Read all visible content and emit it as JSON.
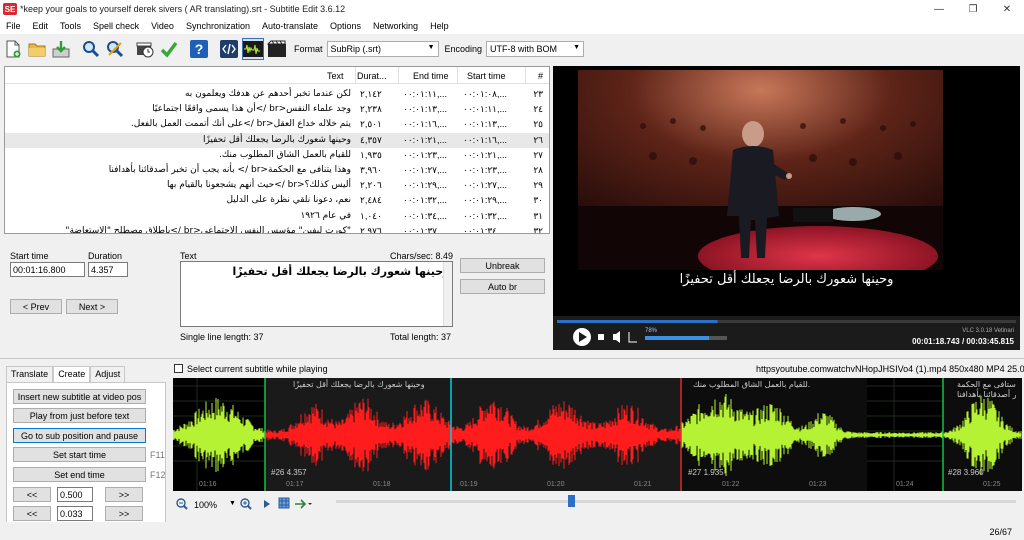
{
  "window": {
    "app_icon": "SE",
    "title": "*keep your goals to yourself derek sivers ( AR translating).srt - Subtitle Edit 3.6.12",
    "minimize": "—",
    "restore": "❐",
    "close": "✕"
  },
  "menu": [
    "File",
    "Edit",
    "Tools",
    "Spell check",
    "Video",
    "Synchronization",
    "Auto-translate",
    "Options",
    "Networking",
    "Help"
  ],
  "toolbar": {
    "icons": [
      "new-file-icon",
      "open-folder-icon",
      "save-icon",
      "find-icon",
      "replace-icon",
      "visual-sync-icon",
      "spell-check-icon",
      "help-icon",
      "source-view-icon",
      "waveform-toggle-icon",
      "video-toggle-icon"
    ],
    "format_label": "Format",
    "format_value": "SubRip (.srt)",
    "encoding_label": "Encoding",
    "encoding_value": "UTF-8 with BOM"
  },
  "list": {
    "headers": {
      "num": "#",
      "start": "Start time",
      "end": "End time",
      "dur": "Durat...",
      "text": "Text"
    },
    "rows": [
      {
        "num": "٢٣",
        "start": "٠٠:٠١:٠٨,...",
        "end": "٠٠:٠١:١١,...",
        "dur": "٢,١٤٢",
        "text": "لكن عندما تخبر أحدهم عن هدفك ويعلمون به"
      },
      {
        "num": "٢٤",
        "start": "٠٠:٠١:١١,...",
        "end": "٠٠:٠١:١٣,...",
        "dur": "٢,٢٣٨",
        "text": "وجد علماء النفس<br />أن هذا يسمى واقعًا اجتماعيًا"
      },
      {
        "num": "٢٥",
        "start": "٠٠:٠١:١٣,...",
        "end": "٠٠:٠١:١٦,...",
        "dur": "٢,٥٠١",
        "text": "يتم  خلاله خداع العقل<br />على أنك أتممت العمل بالفعل."
      },
      {
        "num": "٢٦",
        "start": "٠٠:٠١:١٦,...",
        "end": "٠٠:٠١:٢١,...",
        "dur": "٤,٣٥٧",
        "text": "وحينها شعورك بالرضا يجعلك أقل تحفيزًا"
      },
      {
        "num": "٢٧",
        "start": "٠٠:٠١:٢١,...",
        "end": "٠٠:٠١:٢٣,...",
        "dur": "١,٩٣٥",
        "text": "للقيام بالعمل الشاق المطلوب منك."
      },
      {
        "num": "٢٨",
        "start": "٠٠:٠١:٢٣,...",
        "end": "٠٠:٠١:٢٧,...",
        "dur": "٣,٩٦٠",
        "text": "وهذا يتنافى مع الحكمة<br /> بأنه يجب أن تخبر أصدقائنا بأهدافنا"
      },
      {
        "num": "٢٩",
        "start": "٠٠:٠١:٢٧,...",
        "end": "٠٠:٠١:٢٩,...",
        "dur": "٢,٢٠٦",
        "text": "أليس كذلك؟<br />حيث أنهم يشجعونا بالقيام بها"
      },
      {
        "num": "٣٠",
        "start": "٠٠:٠١:٢٩,...",
        "end": "٠٠:٠١:٣٢,...",
        "dur": "٢,٤٨٤",
        "text": "نعم، دعونا نلقي نظرة على الدليل"
      },
      {
        "num": "٣١",
        "start": "٠٠:٠١:٣٢,...",
        "end": "٠٠:٠١:٣٤,...",
        "dur": "١,٠٤٠",
        "text": "في عام ١٩٢٦"
      },
      {
        "num": "٣٢",
        "start": "٠٠:٠١:٣٤,...",
        "end": "٠٠:٠١:٣٧,...",
        "dur": "٢,٩٧٦",
        "text": "\"كورت ليفين\" مؤسس النفس الإجتماعي<br />بإطلاق مصطلح \"الاستعاضة\""
      }
    ]
  },
  "video": {
    "subtitle": "وحينها شعورك بالرضا يجعلك أقل تحفيزًا",
    "volume": "78%",
    "vlc_label": "VLC 3.0.18 Vetinari",
    "position": "00:01:18.743",
    "separator": " / ",
    "duration": "00:03:45.815",
    "progress": 0.35,
    "volume_level": 0.78
  },
  "edit": {
    "start_label": "Start time",
    "start_value": "00:01:16.800",
    "duration_label": "Duration",
    "duration_value": "4.357",
    "prev": "< Prev",
    "next": "Next >",
    "text_label": "Text",
    "chars_sec": "Chars/sec: 8.49",
    "text_value": "وحينها شعورك بالرضا يجعلك أقل تحفيزًا",
    "single_line": "Single line length: 37",
    "total_length": "Total length: 37",
    "unbreak": "Unbreak",
    "auto_br": "Auto br"
  },
  "lower": {
    "tabs": [
      "Translate",
      "Create",
      "Adjust"
    ],
    "select_checkbox_label": "Select current subtitle while playing",
    "video_info": "httpsyoutube.comwatchvNHopJHSIVo4 (1).mp4 850x480 MP4 25.0",
    "buttons": {
      "insert": "Insert new subtitle at video pos",
      "play_before": "Play from just before text",
      "goto_pause": "Go to sub position and pause",
      "set_start": "Set start time",
      "set_end": "Set end time",
      "f11": "F11",
      "f12": "F12",
      "back": "<<",
      "fwd": ">>",
      "step1": "0.500",
      "step2": "0.033"
    }
  },
  "waveform": {
    "subs": [
      {
        "text": "وحينها شعورك بالرضا يجعلك أقل تحفيزًا",
        "id": "#26  4.357"
      },
      {
        "text": "للقيام بالعمل الشاق المطلوب منك.",
        "id": "#27  1.935"
      },
      {
        "text": "ستافى مع الحكمة",
        "text2": "ر أصدقائنا بأهدافنا",
        "id": "#28  3.960"
      }
    ],
    "ticks": [
      "01:16",
      "01:17",
      "01:18",
      "01:19",
      "01:20",
      "01:21",
      "01:22",
      "01:23",
      "01:24",
      "01:25"
    ],
    "zoom": "100%"
  },
  "status": {
    "count": "26/67"
  },
  "colors": {
    "selected_wave": "#ff1c1c",
    "wave": "#b5f234",
    "selection_bg": "#cfe1f7",
    "accent": "#0078d7"
  }
}
